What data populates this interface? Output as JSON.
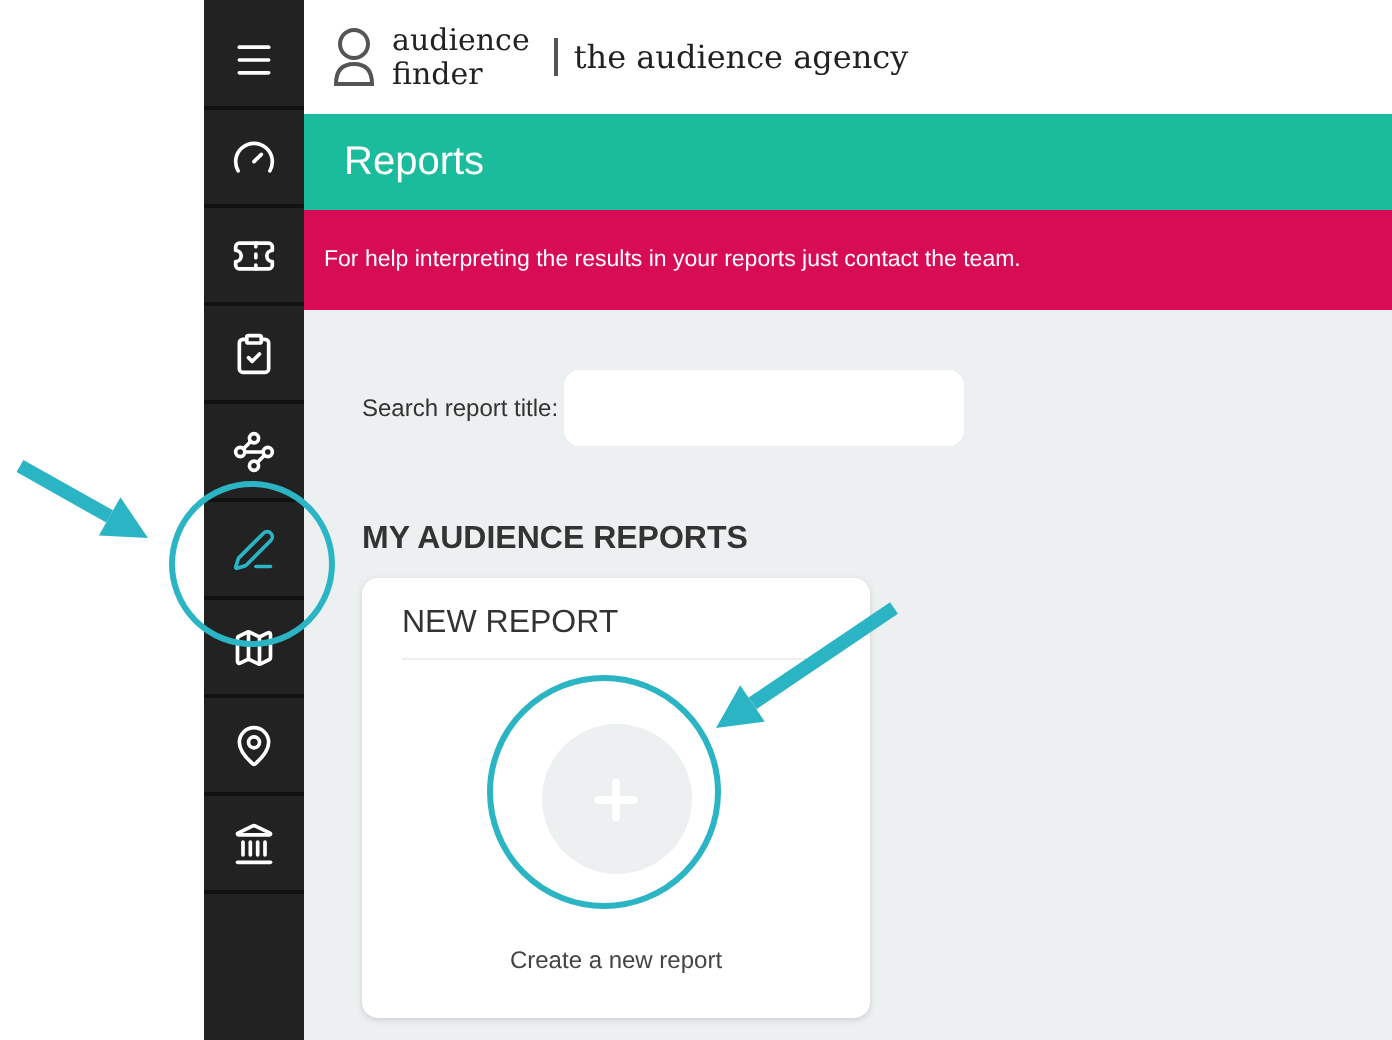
{
  "logo": {
    "line_1": "audience",
    "line_2": "finder",
    "agency": "the audience agency"
  },
  "sidebar": {
    "items": [
      {
        "kind": "menu",
        "selected": false
      },
      {
        "kind": "gauge",
        "selected": false
      },
      {
        "kind": "ticket",
        "selected": false
      },
      {
        "kind": "clipboard",
        "selected": false
      },
      {
        "kind": "nodes",
        "selected": false
      },
      {
        "kind": "pen",
        "selected": true
      },
      {
        "kind": "map",
        "selected": false
      },
      {
        "kind": "pin",
        "selected": false
      },
      {
        "kind": "figure",
        "selected": false
      }
    ]
  },
  "page_title": "Reports",
  "banner": "For help interpreting the results in your reports just contact the team.",
  "search": {
    "label": "Search report title:"
  },
  "section_title": "MY AUDIENCE REPORTS",
  "card": {
    "title": "NEW REPORT",
    "caption": "Create a new report"
  }
}
